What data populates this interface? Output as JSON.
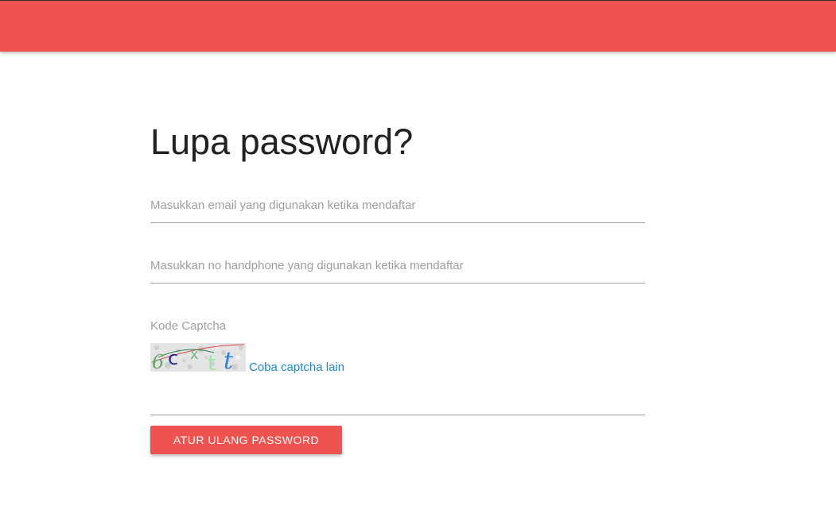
{
  "header": {
    "brand_color": "#ef5350"
  },
  "form": {
    "title": "Lupa password?",
    "email_placeholder": "Masukkan email yang digunakan ketika mendaftar",
    "email_value": "",
    "phone_placeholder": "Masukkan no handphone yang digunakan ketika mendaftar",
    "phone_value": "",
    "captcha_label": "Kode Captcha",
    "captcha_text": "6cxtt",
    "captcha_refresh_label": "Coba captcha lain",
    "captcha_value": "",
    "submit_label": "ATUR ULANG PASSWORD"
  },
  "colors": {
    "accent": "#ef5350",
    "link": "#1e88c9",
    "placeholder": "#9e9e9e",
    "title": "#212121"
  }
}
